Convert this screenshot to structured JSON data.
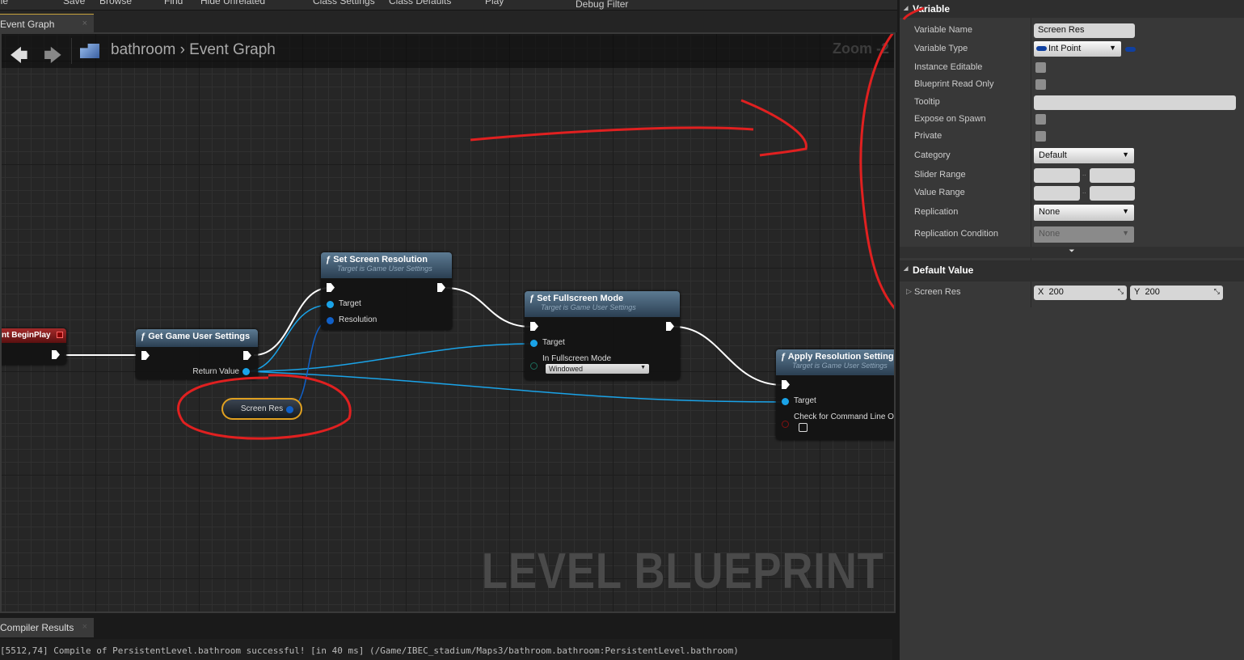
{
  "toolbar": {
    "items": [
      "ile",
      "Save",
      "Browse",
      "Find",
      "Hide Unrelated",
      "Class Settings",
      "Class Defaults",
      "Play",
      "Debug Filter"
    ]
  },
  "tab": {
    "label": "Event Graph",
    "close": "×"
  },
  "breadcrumb": {
    "root": "bathroom",
    "sep": "›",
    "current": "Event Graph"
  },
  "graph": {
    "zoom": "Zoom -2",
    "watermark": "LEVEL BLUEPRINT"
  },
  "nodes": {
    "begin_play": {
      "title": "nt BeginPlay"
    },
    "get_settings": {
      "title": "Get Game User Settings",
      "return": "Return Value"
    },
    "set_res": {
      "title": "Set Screen Resolution",
      "sub": "Target is Game User Settings",
      "target": "Target",
      "resolution": "Resolution"
    },
    "set_fullscreen": {
      "title": "Set Fullscreen Mode",
      "sub": "Target is Game User Settings",
      "target": "Target",
      "mode_label": "In Fullscreen Mode",
      "mode_value": "Windowed"
    },
    "apply": {
      "title": "Apply Resolution Settings",
      "sub": "Target is Game User Settings",
      "target": "Target",
      "check": "Check for Command Line Overr"
    },
    "var": {
      "title": "Screen Res"
    }
  },
  "bottom": {
    "tab": "Compiler Results",
    "close": "×",
    "log": "[5512,74] Compile of PersistentLevel.bathroom successful! [in 40 ms] (/Game/IBEC_stadium/Maps3/bathroom.bathroom:PersistentLevel.bathroom)"
  },
  "details": {
    "variable_header": "Variable",
    "labels": {
      "name": "Variable Name",
      "type": "Variable Type",
      "instance": "Instance Editable",
      "readonly": "Blueprint Read Only",
      "tooltip": "Tooltip",
      "expose": "Expose on Spawn",
      "private": "Private",
      "category": "Category",
      "slider": "Slider Range",
      "range": "Value Range",
      "replication": "Replication",
      "repcond": "Replication Condition"
    },
    "values": {
      "name": "Screen Res",
      "type": "Int Point",
      "category": "Default",
      "replication": "None",
      "repcond": "None",
      "range_sep": ".."
    },
    "default_header": "Default Value",
    "default": {
      "label": "Screen Res",
      "x_label": "X",
      "x": "200",
      "y_label": "Y",
      "y": "200"
    }
  },
  "colors": {
    "accent": "#e0a020",
    "pin": "#1aa3e8",
    "annotation": "#e02020"
  }
}
